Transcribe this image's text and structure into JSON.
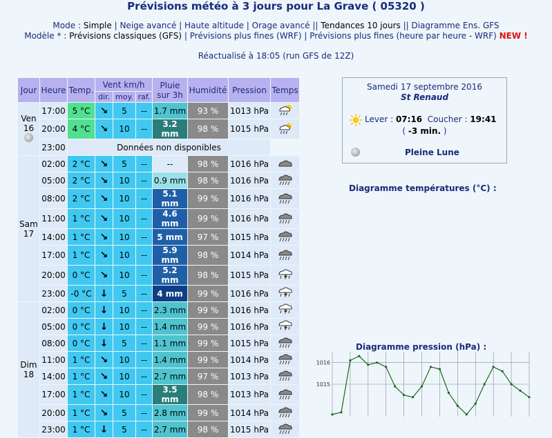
{
  "title": "Prévisions météo à 3 jours pour La Grave ( 05320 )",
  "mode_line": {
    "label": "Mode : ",
    "items": [
      "Simple",
      "Neige avancé",
      "Haute altitude",
      "Orage avancé",
      "Tendances 10 jours",
      "Diagramme Ens. GFS"
    ]
  },
  "model_line": {
    "label": "Modèle * : ",
    "items": [
      "Prévisions classiques (GFS)",
      "Prévisions plus fines (WRF)",
      "Prévisions plus fines (heure par heure - WRF)"
    ],
    "new_badge": "NEW !"
  },
  "updated": "Réactualisé à 18:05 (run GFS de 12Z)",
  "table": {
    "headers": {
      "jour": "Jour",
      "heure": "Heure",
      "temp": "Temp.",
      "vent": "Vent km/h",
      "pluie1": "Pluie",
      "pluie2": "sur 3h",
      "hum": "Humidité",
      "pression": "Pression",
      "temps": "Temps",
      "dir": "dir.",
      "moy": "moy.",
      "raf": "raf."
    },
    "days": [
      {
        "label1": "Ven",
        "label2": "16",
        "rows": [
          {
            "h": "17:00",
            "t": "5 °C",
            "tc": "warm",
            "d": "↘",
            "m": "5",
            "r": "--",
            "p": "1.7 mm",
            "pc": "l2",
            "hu": "93 %",
            "pr": "1013 hPa",
            "w": "sun-rain"
          },
          {
            "h": "20:00",
            "t": "4 °C",
            "tc": "warm",
            "d": "↘",
            "m": "10",
            "r": "--",
            "p": "3.2 mm",
            "pc": "l3",
            "hu": "98 %",
            "pr": "1015 hPa",
            "w": "sun-rain"
          },
          {
            "h": "23:00",
            "na": "Données non disponibles"
          }
        ]
      },
      {
        "label1": "Sam",
        "label2": "17",
        "rows": [
          {
            "h": "02:00",
            "t": "2 °C",
            "tc": "cold",
            "d": "↘",
            "m": "5",
            "r": "--",
            "p": "--",
            "pc": "none",
            "hu": "98 %",
            "pr": "1016 hPa",
            "w": "cloud"
          },
          {
            "h": "05:00",
            "t": "2 °C",
            "tc": "cold",
            "d": "↘",
            "m": "10",
            "r": "--",
            "p": "0.9 mm",
            "pc": "l1",
            "hu": "98 %",
            "pr": "1016 hPa",
            "w": "rain"
          },
          {
            "h": "08:00",
            "t": "2 °C",
            "tc": "cold",
            "d": "↘",
            "m": "10",
            "r": "--",
            "p": "5.1 mm",
            "pc": "h1",
            "hu": "99 %",
            "pr": "1016 hPa",
            "w": "rain"
          },
          {
            "h": "11:00",
            "t": "1 °C",
            "tc": "cold",
            "d": "↘",
            "m": "10",
            "r": "--",
            "p": "4.6 mm",
            "pc": "h1",
            "hu": "99 %",
            "pr": "1016 hPa",
            "w": "rain"
          },
          {
            "h": "14:00",
            "t": "1 °C",
            "tc": "cold",
            "d": "↘",
            "m": "10",
            "r": "--",
            "p": "5 mm",
            "pc": "h1",
            "hu": "97 %",
            "pr": "1015 hPa",
            "w": "rain"
          },
          {
            "h": "17:00",
            "t": "1 °C",
            "tc": "cold",
            "d": "↘",
            "m": "10",
            "r": "--",
            "p": "5.9 mm",
            "pc": "h1",
            "hu": "98 %",
            "pr": "1014 hPa",
            "w": "rain"
          },
          {
            "h": "20:00",
            "t": "0 °C",
            "tc": "cold",
            "d": "↘",
            "m": "10",
            "r": "--",
            "p": "5.2 mm",
            "pc": "h1",
            "hu": "98 %",
            "pr": "1015 hPa",
            "w": "storm"
          },
          {
            "h": "23:00",
            "t": "-0 °C",
            "tc": "cold",
            "d": "↓",
            "m": "5",
            "r": "--",
            "p": "4 mm",
            "pc": "h2",
            "hu": "99 %",
            "pr": "1016 hPa",
            "w": "storm"
          }
        ]
      },
      {
        "label1": "Dim",
        "label2": "18",
        "rows": [
          {
            "h": "02:00",
            "t": "0 °C",
            "tc": "cold",
            "d": "↓",
            "m": "10",
            "r": "--",
            "p": "2.3 mm",
            "pc": "l2",
            "hu": "99 %",
            "pr": "1016 hPa",
            "w": "storm"
          },
          {
            "h": "05:00",
            "t": "0 °C",
            "tc": "cold",
            "d": "↓",
            "m": "10",
            "r": "--",
            "p": "1.4 mm",
            "pc": "l2",
            "hu": "99 %",
            "pr": "1016 hPa",
            "w": "storm"
          },
          {
            "h": "08:00",
            "t": "0 °C",
            "tc": "cold",
            "d": "↓",
            "m": "5",
            "r": "--",
            "p": "1.1 mm",
            "pc": "l2",
            "hu": "99 %",
            "pr": "1015 hPa",
            "w": "rain"
          },
          {
            "h": "11:00",
            "t": "1 °C",
            "tc": "cold",
            "d": "↘",
            "m": "10",
            "r": "--",
            "p": "1.4 mm",
            "pc": "l2",
            "hu": "99 %",
            "pr": "1014 hPa",
            "w": "rain"
          },
          {
            "h": "14:00",
            "t": "1 °C",
            "tc": "cold",
            "d": "↘",
            "m": "10",
            "r": "--",
            "p": "2.7 mm",
            "pc": "l2",
            "hu": "97 %",
            "pr": "1013 hPa",
            "w": "rain"
          },
          {
            "h": "17:00",
            "t": "1 °C",
            "tc": "cold",
            "d": "↘",
            "m": "10",
            "r": "--",
            "p": "3.5 mm",
            "pc": "l3",
            "hu": "98 %",
            "pr": "1013 hPa",
            "w": "rain"
          },
          {
            "h": "20:00",
            "t": "1 °C",
            "tc": "cold",
            "d": "↘",
            "m": "5",
            "r": "--",
            "p": "2.8 mm",
            "pc": "l2",
            "hu": "99 %",
            "pr": "1014 hPa",
            "w": "rain"
          },
          {
            "h": "23:00",
            "t": "1 °C",
            "tc": "cold",
            "d": "↓",
            "m": "5",
            "r": "--",
            "p": "2.7 mm",
            "pc": "l2",
            "hu": "98 %",
            "pr": "1015 hPa",
            "w": "rain"
          }
        ]
      }
    ]
  },
  "sunbox": {
    "date": "Samedi 17 septembre 2016",
    "saint": "St Renaud",
    "lever_label": "Lever : ",
    "lever": "07:16",
    "coucher_label": "Coucher : ",
    "coucher": "19:41",
    "duration": "-3 min.",
    "moon_phase": "Pleine Lune"
  },
  "temp_chart_title": "Diagramme températures (°C) :",
  "pressure_chart_title": "Diagramme pression (hPa) :",
  "chart_data": {
    "type": "line",
    "title": "Diagramme pression (hPa) :",
    "yticks": [
      1016,
      1015
    ],
    "series": [
      {
        "values": [
          1013.6,
          1013.7,
          1016.1,
          1016.3,
          1015.9,
          1016.0,
          1015.8,
          1014.9,
          1014.5,
          1014.4,
          1014.9,
          1015.8,
          1015.7,
          1014.6,
          1014.0,
          1013.6,
          1014.1,
          1015.0,
          1015.8,
          1015.6,
          1015.0,
          1014.7,
          1014.4
        ]
      }
    ],
    "ylim": [
      1013.5,
      1016.5
    ],
    "grid": true
  }
}
